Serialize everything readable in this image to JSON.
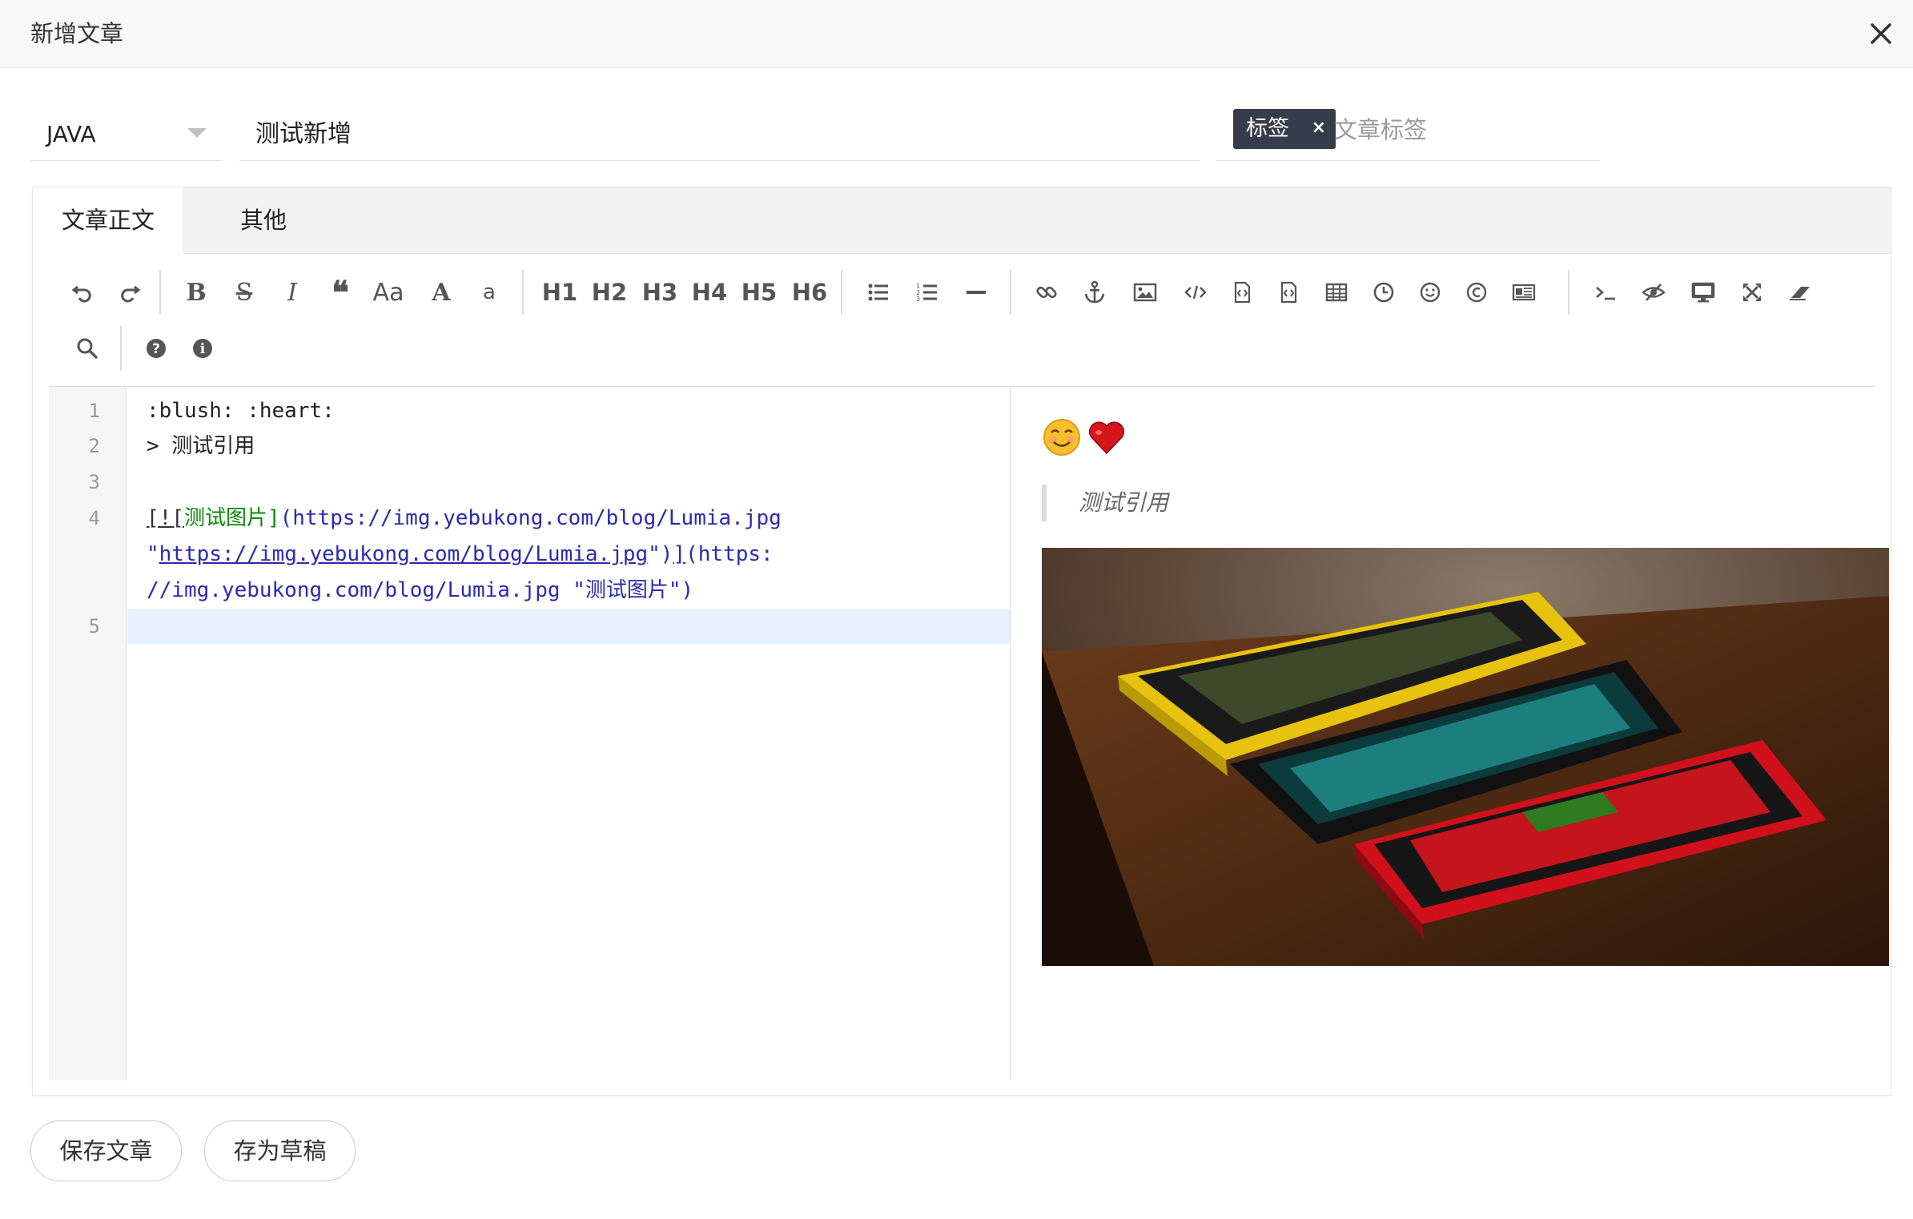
{
  "dialog": {
    "title": "新增文章"
  },
  "form": {
    "category": "JAVA",
    "title": "测试新增",
    "tag": "标签",
    "tag_remove": "×",
    "tag_placeholder": "文章标签"
  },
  "tabs": [
    {
      "label": "文章正文",
      "active": true
    },
    {
      "label": "其他",
      "active": false
    }
  ],
  "toolbar": {
    "headings": [
      "H1",
      "H2",
      "H3",
      "H4",
      "H5",
      "H6"
    ],
    "font_glyphs": [
      "Aa",
      "A",
      "a"
    ],
    "icons": [
      "undo-icon",
      "redo-icon",
      "bold-icon",
      "strikethrough-icon",
      "italic-icon",
      "quote-icon",
      "uppercase-icon",
      "uppercase-first-icon",
      "lowercase-icon",
      "h1",
      "h2",
      "h3",
      "h4",
      "h5",
      "h6",
      "unordered-list-icon",
      "ordered-list-icon",
      "hr-icon",
      "link-icon",
      "anchor-icon",
      "image-icon",
      "code-icon",
      "preformatted-code-icon",
      "code-block-icon",
      "table-icon",
      "datetime-icon",
      "emoji-icon",
      "html-entities-icon",
      "pagebreak-icon",
      "goto-line-icon",
      "watch-toggle-icon",
      "preview-icon",
      "fullscreen-icon",
      "clear-icon",
      "search-icon",
      "help-icon",
      "info-icon"
    ]
  },
  "editor": {
    "line_numbers": [
      "1",
      "2",
      "3",
      "4",
      "5"
    ],
    "lines": {
      "l1": ":blush: :heart:",
      "l2": "> 测试引用",
      "l4a_open": "[![",
      "l4a_alt": "测试图片",
      "l4a_close": "]",
      "l4a_url": "(https://img.yebukong.com/blog/Lumia.jpg",
      "l4b_q1": "\"",
      "l4b_url": "https://img.yebukong.com/blog/Lumia.jpg",
      "l4b_q2": "\")",
      "l4b_close": "]",
      "l4b_url2": "(https:",
      "l4c": "//img.yebukong.com/blog/Lumia.jpg \"测试图片\")"
    }
  },
  "preview": {
    "quote": "测试引用",
    "emojis": [
      "blush",
      "heart"
    ]
  },
  "buttons": {
    "save": "保存文章",
    "draft": "存为草稿"
  }
}
